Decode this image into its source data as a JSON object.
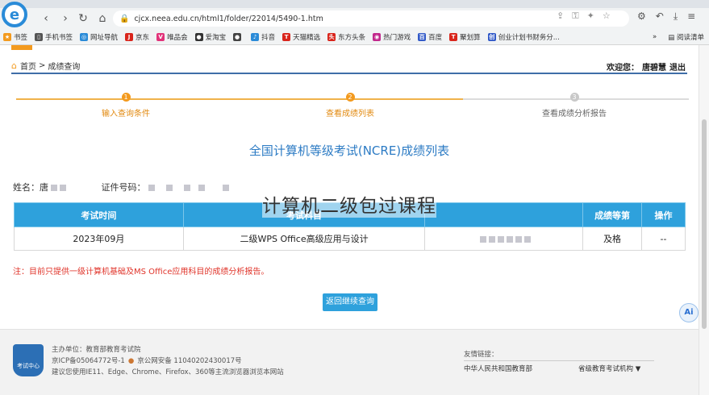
{
  "browser": {
    "url": "cjcx.neea.edu.cn/html1/folder/22014/5490-1.htm",
    "bookmarks": [
      "书签",
      "手机书签",
      "网址导航",
      "京东",
      "唯品会",
      "爱淘宝",
      "",
      "抖音",
      "天猫精选",
      "东方头条",
      "热门游戏",
      "百度",
      "聚划算",
      "创业计划书财务分..."
    ],
    "bookmark_more": "»",
    "reading_list": "阅读清单"
  },
  "header": {
    "home": "首页",
    "separator": ">",
    "crumb": "成绩查询",
    "welcome": "欢迎您：",
    "user": "唐碧慧",
    "logout": "退出"
  },
  "steps": [
    {
      "num": "1",
      "label": "输入查询条件"
    },
    {
      "num": "2",
      "label": "查看成绩列表"
    },
    {
      "num": "3",
      "label": "查看成绩分析报告"
    }
  ],
  "title": "全国计算机等级考试(NCRE)成绩列表",
  "info": {
    "name_label": "姓名：",
    "name_value": "唐",
    "id_label": "证件号码："
  },
  "table": {
    "headers": [
      "考试时间",
      "考试科目",
      "",
      "成绩等第",
      "操作"
    ],
    "rows": [
      {
        "time": "2023年09月",
        "subject": "二级WPS Office高级应用与设计",
        "level": "及格",
        "action": "--"
      }
    ]
  },
  "note": "注：目前只提供一级计算机基础及MS Office应用科目的成绩分析报告。",
  "back_button": "返回继续查询",
  "ai_badge": "Ai",
  "footer": {
    "emblem": "考试中心",
    "line1": "主办单位：教育部教育考试院",
    "line2a": "京ICP备05064772号-1",
    "line2b": "京公网安备 11040202430017号",
    "line3": "建议您使用IE11、Edge、Chrome、Firefox、360等主流浏览器浏览本网站",
    "friend_title": "友情链接：",
    "friend_left": "中华人民共和国教育部",
    "friend_right": "省级教育考试机构 ▼"
  },
  "watermark": "计算机二级包过课程",
  "colors": {
    "accent_orange": "#f39a1e",
    "table_header": "#2ea1dc",
    "title_blue": "#2c7bc4",
    "note_red": "#e0352b"
  }
}
